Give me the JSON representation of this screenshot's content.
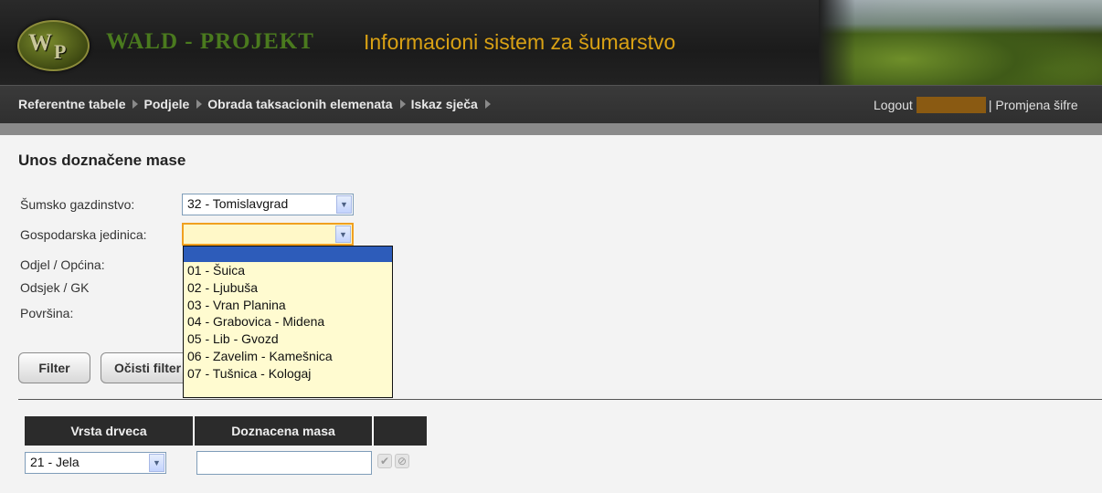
{
  "header": {
    "logo_text": "WP",
    "brand": "WALD - PROJEKT",
    "app_title": "Informacioni sistem za šumarstvo"
  },
  "nav": {
    "items": [
      {
        "label": "Referentne tabele"
      },
      {
        "label": "Podjele"
      },
      {
        "label": "Obrada taksacionih elemenata"
      },
      {
        "label": "Iskaz sječa"
      }
    ],
    "logout": "Logout",
    "change_password": "| Promjena šifre"
  },
  "page": {
    "title": "Unos doznačene mase"
  },
  "form": {
    "sumsko_gazdinstvo_label": "Šumsko gazdinstvo:",
    "sumsko_gazdinstvo_value": "32 - Tomislavgrad",
    "gospodarska_jedinica_label": "Gospodarska jedinica:",
    "gospodarska_jedinica_value": "",
    "odjel_label": "Odjel / Općina:",
    "odsjek_label": "Odsjek / GK",
    "povrsina_label": "Površina:"
  },
  "dropdown": {
    "options": [
      "01 - Šuica",
      "02 - Ljubuša",
      "03 - Vran Planina",
      "04 - Grabovica - Midena",
      "05 - Lib - Gvozd",
      "06 - Zavelim - Kamešnica",
      "07 - Tušnica - Kologaj"
    ]
  },
  "buttons": {
    "filter": "Filter",
    "clear_filter": "Očisti filter"
  },
  "table": {
    "headers": [
      "Vrsta drveca",
      "Doznacena masa",
      ""
    ],
    "row": {
      "vrsta": "21 - Jela",
      "masa": ""
    }
  },
  "colors": {
    "brand_green": "#4a7a1e",
    "title_gold": "#d9a114",
    "dropdown_highlight": "#2d5cba",
    "dropdown_bg": "#fffbd0"
  }
}
